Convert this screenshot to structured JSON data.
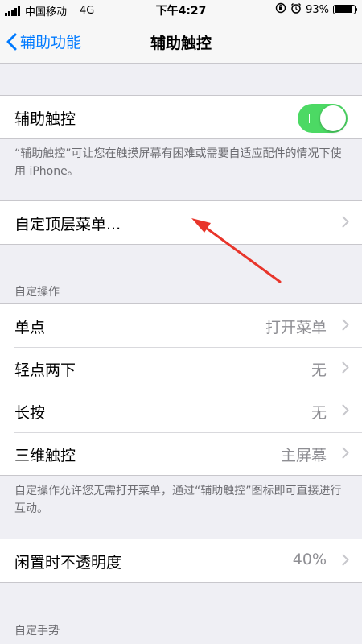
{
  "status_bar": {
    "carrier": "中国移动",
    "network": "4G",
    "time": "下午4:27",
    "battery": "93%",
    "battery_level": 0.93
  },
  "nav": {
    "back_label": "辅助功能",
    "title": "辅助触控"
  },
  "main_toggle": {
    "label": "辅助触控",
    "on": true,
    "note": "“辅助触控”可让您在触摸屏幕有困难或需要自适应配件的情况下使用 iPhone。"
  },
  "top_menu": {
    "label": "自定顶层菜单..."
  },
  "custom_actions": {
    "header": "自定操作",
    "rows": [
      {
        "label": "单点",
        "value": "打开菜单"
      },
      {
        "label": "轻点两下",
        "value": "无"
      },
      {
        "label": "长按",
        "value": "无"
      },
      {
        "label": "三维触控",
        "value": "主屏幕"
      }
    ],
    "note": "自定操作允许您无需打开菜单，通过“辅助触控”图标即可直接进行互动。"
  },
  "opacity": {
    "label": "闲置时不透明度",
    "value": "40%"
  },
  "gestures": {
    "header": "自定手势"
  },
  "colors": {
    "accent": "#007aff",
    "toggle_on": "#4cd964",
    "annotation": "#e8352b"
  },
  "icons": [
    "signal-icon",
    "orientation-lock-icon",
    "alarm-icon",
    "battery-icon",
    "chevron-left-icon",
    "chevron-right-icon"
  ]
}
